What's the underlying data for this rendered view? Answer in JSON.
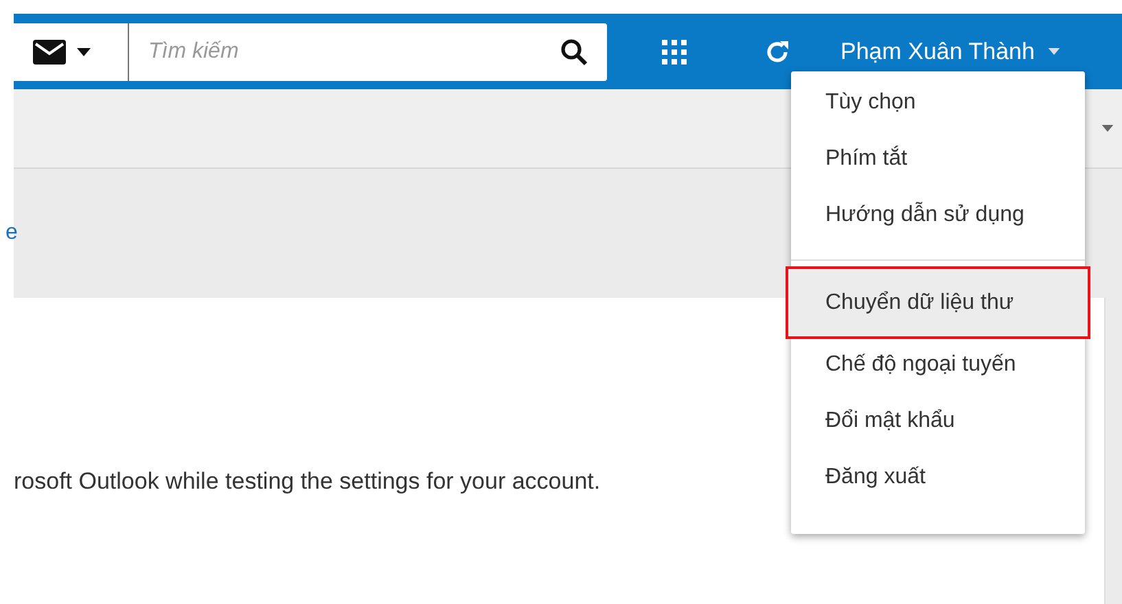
{
  "header": {
    "search": {
      "placeholder": "Tìm kiếm"
    },
    "user_name": "Phạm Xuân Thành"
  },
  "content": {
    "link_fragment": "e",
    "message": "rosoft Outlook while testing the settings for your account."
  },
  "user_menu": {
    "groups": [
      [
        {
          "label": "Tùy chọn",
          "selected": false,
          "outlined": false
        },
        {
          "label": "Phím tắt",
          "selected": false,
          "outlined": false
        },
        {
          "label": "Hướng dẫn sử dụng",
          "selected": false,
          "outlined": false
        }
      ],
      [
        {
          "label": "Chuyển dữ liệu thư",
          "selected": true,
          "outlined": true
        }
      ],
      [
        {
          "label": "Chế độ ngoại tuyến",
          "selected": false,
          "outlined": false
        },
        {
          "label": "Đổi mật khẩu",
          "selected": false,
          "outlined": false
        },
        {
          "label": "Đăng xuất",
          "selected": false,
          "outlined": false
        }
      ]
    ]
  }
}
